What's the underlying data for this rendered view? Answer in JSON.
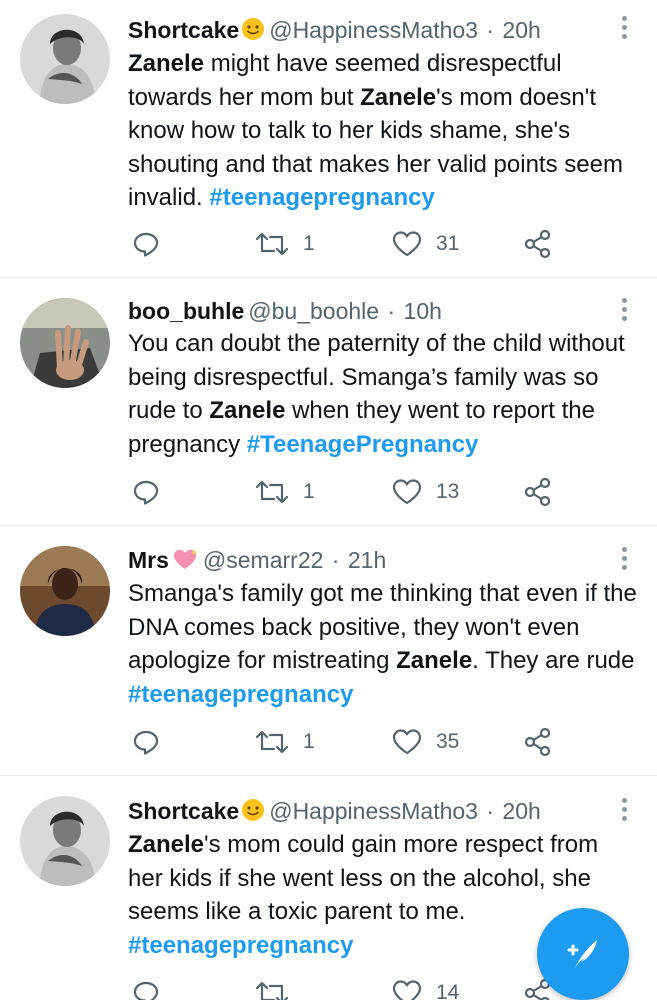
{
  "tweets": [
    {
      "name": "Shortcake",
      "emoji": "smiling-face-emoji",
      "handle": "@HappinessMatho3",
      "time": "20h",
      "sep": "·",
      "text": [
        {
          "t": "Zanele",
          "s": "bold"
        },
        {
          "t": " might have seemed disrespectful towards her mom but ",
          "s": "plain"
        },
        {
          "t": "Zanele",
          "s": "bold"
        },
        {
          "t": "'s mom doesn't know how to talk to her kids shame, she's shouting and that makes her valid points seem invalid. ",
          "s": "plain"
        },
        {
          "t": "#teenagepregnancy",
          "s": "tag"
        }
      ],
      "replies": "",
      "retweets": "1",
      "likes": "31"
    },
    {
      "name": "boo_buhle",
      "emoji": "",
      "handle": "@bu_boohle",
      "time": "10h",
      "sep": "·",
      "text": [
        {
          "t": "You can doubt the paternity of the child without being disrespectful. Smanga’s family was so rude to ",
          "s": "plain"
        },
        {
          "t": "Zanele",
          "s": "bold"
        },
        {
          "t": " when they went to report the pregnancy ",
          "s": "plain"
        },
        {
          "t": "#TeenagePregnancy",
          "s": "tag"
        }
      ],
      "replies": "",
      "retweets": "1",
      "likes": "13"
    },
    {
      "name": "Mrs",
      "emoji": "sparkling-heart-emoji",
      "handle": "@semarr22",
      "time": "21h",
      "sep": "·",
      "text": [
        {
          "t": "Smanga's family got me thinking that even if the DNA comes back positive, they won't even apologize for mistreating ",
          "s": "plain"
        },
        {
          "t": "Zanele",
          "s": "bold"
        },
        {
          "t": ". They are rude ",
          "s": "plain"
        },
        {
          "t": "#teenagepregnancy",
          "s": "tag"
        }
      ],
      "replies": "",
      "retweets": "1",
      "likes": "35"
    },
    {
      "name": "Shortcake",
      "emoji": "smiling-face-emoji",
      "handle": "@HappinessMatho3",
      "time": "20h",
      "sep": "·",
      "text": [
        {
          "t": "Zanele",
          "s": "bold"
        },
        {
          "t": "'s mom could gain more respect from her kids if she went less on the alcohol, she seems like a toxic parent to me. ",
          "s": "plain"
        },
        {
          "t": "#teenagepregnancy",
          "s": "tag"
        }
      ],
      "replies": "",
      "retweets": "",
      "likes": "14"
    }
  ],
  "icons": {
    "reply": "reply-icon",
    "retweet": "retweet-icon",
    "like": "heart-icon",
    "share": "share-icon",
    "more": "more-options-icon",
    "compose": "compose-tweet-icon"
  },
  "colors": {
    "accent": "#1d9bf0",
    "text": "#0f1419",
    "muted": "#536471",
    "divider": "#e6ecf0"
  }
}
